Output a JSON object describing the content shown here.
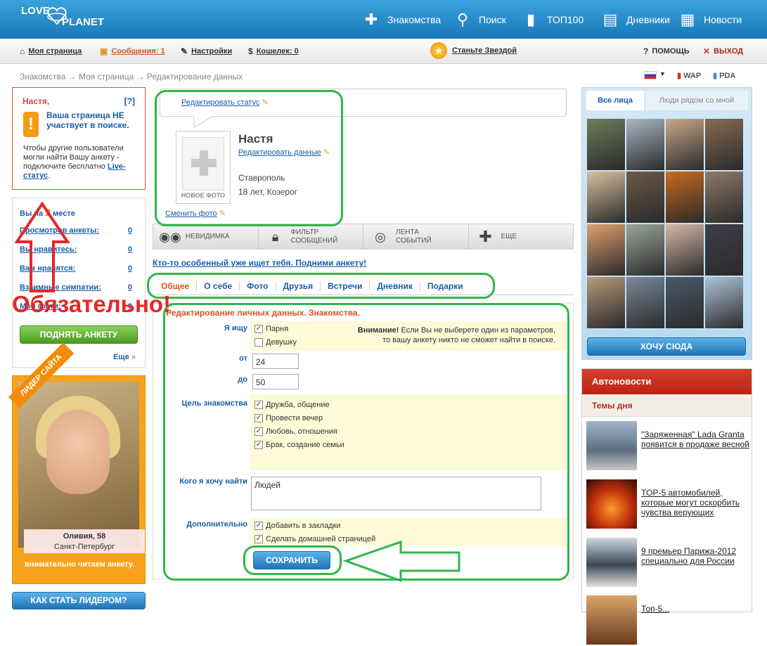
{
  "header": {
    "logo_top": "LOVE",
    "logo_bottom": "PLANET",
    "nav": [
      {
        "label": "Знакомства",
        "icon": "dating-icon"
      },
      {
        "label": "Поиск",
        "icon": "search-icon"
      },
      {
        "label": "ТОП100",
        "icon": "top100-icon"
      },
      {
        "label": "Дневники",
        "icon": "diary-icon"
      },
      {
        "label": "Новости",
        "icon": "news-icon"
      }
    ]
  },
  "subbar": {
    "my_page": "Моя страница",
    "messages": "Сообщения: 1",
    "settings": "Настройки",
    "wallet": "Кошелек: 0",
    "star": "Станьте Звездой",
    "help": "ПОМОЩЬ",
    "exit": "ВЫХОД"
  },
  "breadcrumb": "Знакомства → Моя страница → Редактирование данных",
  "versions": {
    "wap": "WAP",
    "pda": "PDA"
  },
  "warning": {
    "name": "Настя,",
    "help": "[?]",
    "mark": "!",
    "title": "Ваша страница НЕ участвует в поиске.",
    "text": "Чтобы другие пользователи могли найти Вашу анкету - подключите бесплатно",
    "link": "Live-статус",
    "dot": "."
  },
  "stats": {
    "rank_prefix": "Вы на",
    "rank_value": "2",
    "rank_suffix": "месте",
    "items": [
      {
        "label": "Просмотров анкеты:",
        "value": "0"
      },
      {
        "label": "Вы нравитесь:",
        "value": "0"
      },
      {
        "label": "Вам нравятся:",
        "value": "0"
      },
      {
        "label": "Взаимные симпатии:",
        "value": "0"
      },
      {
        "label": "Мои гости:",
        "value": "0"
      }
    ],
    "raise_btn": "ПОДНЯТЬ АНКЕТУ",
    "more": "Еще"
  },
  "leader": {
    "ribbon": "ЛИДЕР САЙТА",
    "name": "Оливия, 58",
    "city": "Санкт-Петербург",
    "caption": "внимательно читаем анкету.",
    "button": "КАК СТАТЬ ЛИДЕРОМ?"
  },
  "profile": {
    "edit_status": "Редактировать статус",
    "name": "Настя",
    "edit_data": "Редактировать данные",
    "city": "Ставрополь",
    "age": "18 лет, Козерог",
    "new_photo": "НОВОЕ ФОТО",
    "change_photo": "Сменить фото"
  },
  "toolbar": [
    {
      "label": "НЕВИДИМКА",
      "icon": "glasses-icon"
    },
    {
      "label": "ФИЛЬТР СООБЩЕНИЙ",
      "icon": "lock-icon"
    },
    {
      "label": "ЛЕНТА СОБЫТИЙ",
      "icon": "disc-icon"
    },
    {
      "label": "ЕЩЕ",
      "icon": "plus-icon"
    }
  ],
  "promo": "Кто-то особенный уже ищет тебя. Подними анкету!",
  "tabs": [
    "Общее",
    "О себе",
    "Фото",
    "Друзья",
    "Встречи",
    "Дневник",
    "Подарки"
  ],
  "form": {
    "title": "Редактирование личных данных. Знакомства.",
    "seek_label": "Я ищу",
    "seek_options": [
      "Парня",
      "Девушку"
    ],
    "attention_bold": "Внимание!",
    "attention_text": "Если Вы не выберете один из параметров, то вашу анкету никто не сможет найти в поиске.",
    "from_label": "от",
    "from_value": "24",
    "to_label": "до",
    "to_value": "50",
    "goal_label": "Цель знакомства",
    "goals": [
      "Дружба, общение",
      "Провести вечер",
      "Любовь, отношения",
      "Брак, создание семьи"
    ],
    "who_label": "Кого я хочу найти",
    "who_value": "Людей",
    "extra_label": "Дополнительно",
    "extras": [
      "Добавить в закладки",
      "Сделать домашней страницей"
    ],
    "save": "СОХРАНИТЬ"
  },
  "annotation": "Обязательно!",
  "faces": {
    "tab_all": "Все лица",
    "tab_near": "Люди рядом со мной",
    "button": "ХОЧУ СЮДА"
  },
  "autonews": {
    "title": "Автоновости",
    "subtitle": "Темы дня",
    "items": [
      "\"Заряженная\" Lada Granta появится в продаже весной",
      "TOP-5 автомобилей, которые могут оскорбить чувства верующих",
      "9 премьер Парижа-2012 специально для России",
      "Топ-5..."
    ]
  }
}
